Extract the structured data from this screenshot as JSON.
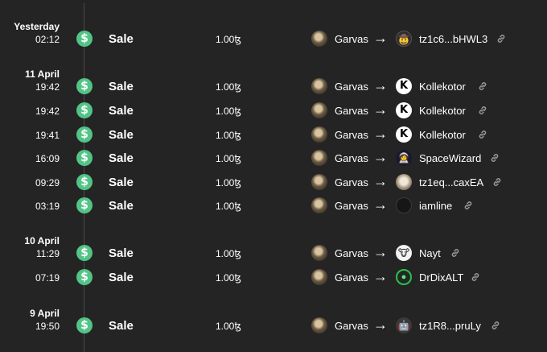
{
  "days": [
    {
      "label": "Yesterday",
      "rows": [
        {
          "time": "02:12",
          "event": "Sale",
          "amount": "1.00ꜩ",
          "from": "Garvas",
          "to": "tz1c6...bHWL3",
          "to_avatar": "cowboy-avatar"
        }
      ]
    },
    {
      "label": "11 April",
      "rows": [
        {
          "time": "19:42",
          "event": "Sale",
          "amount": "1.00ꜩ",
          "from": "Garvas",
          "to": "Kollekotor",
          "to_avatar": "kollekotor-avatar"
        },
        {
          "time": "19:42",
          "event": "Sale",
          "amount": "1.00ꜩ",
          "from": "Garvas",
          "to": "Kollekotor",
          "to_avatar": "kollekotor-avatar"
        },
        {
          "time": "19:41",
          "event": "Sale",
          "amount": "1.00ꜩ",
          "from": "Garvas",
          "to": "Kollekotor",
          "to_avatar": "kollekotor-avatar"
        },
        {
          "time": "16:09",
          "event": "Sale",
          "amount": "1.00ꜩ",
          "from": "Garvas",
          "to": "SpaceWizard",
          "to_avatar": "wizard-avatar"
        },
        {
          "time": "09:29",
          "event": "Sale",
          "amount": "1.00ꜩ",
          "from": "Garvas",
          "to": "tz1eq...caxEA",
          "to_avatar": "portrait-avatar"
        },
        {
          "time": "03:19",
          "event": "Sale",
          "amount": "1.00ꜩ",
          "from": "Garvas",
          "to": "iamline",
          "to_avatar": "empty-avatar"
        }
      ]
    },
    {
      "label": "10 April",
      "rows": [
        {
          "time": "11:29",
          "event": "Sale",
          "amount": "1.00ꜩ",
          "from": "Garvas",
          "to": "Nayt",
          "to_avatar": "nayt-avatar"
        },
        {
          "time": "07:19",
          "event": "Sale",
          "amount": "1.00ꜩ",
          "from": "Garvas",
          "to": "DrDixALT",
          "to_avatar": "drdix-avatar"
        }
      ]
    },
    {
      "label": "9 April",
      "rows": [
        {
          "time": "19:50",
          "event": "Sale",
          "amount": "1.00ꜩ",
          "from": "Garvas",
          "to": "tz1R8...pruLy",
          "to_avatar": "robot-avatar"
        }
      ]
    }
  ],
  "icons": {
    "sale": "dollar-icon",
    "arrow": "right-arrow-icon",
    "link": "link-icon"
  },
  "colors": {
    "background": "#242424",
    "sale_icon": "#52c486",
    "link_icon": "#9a9a9a"
  }
}
